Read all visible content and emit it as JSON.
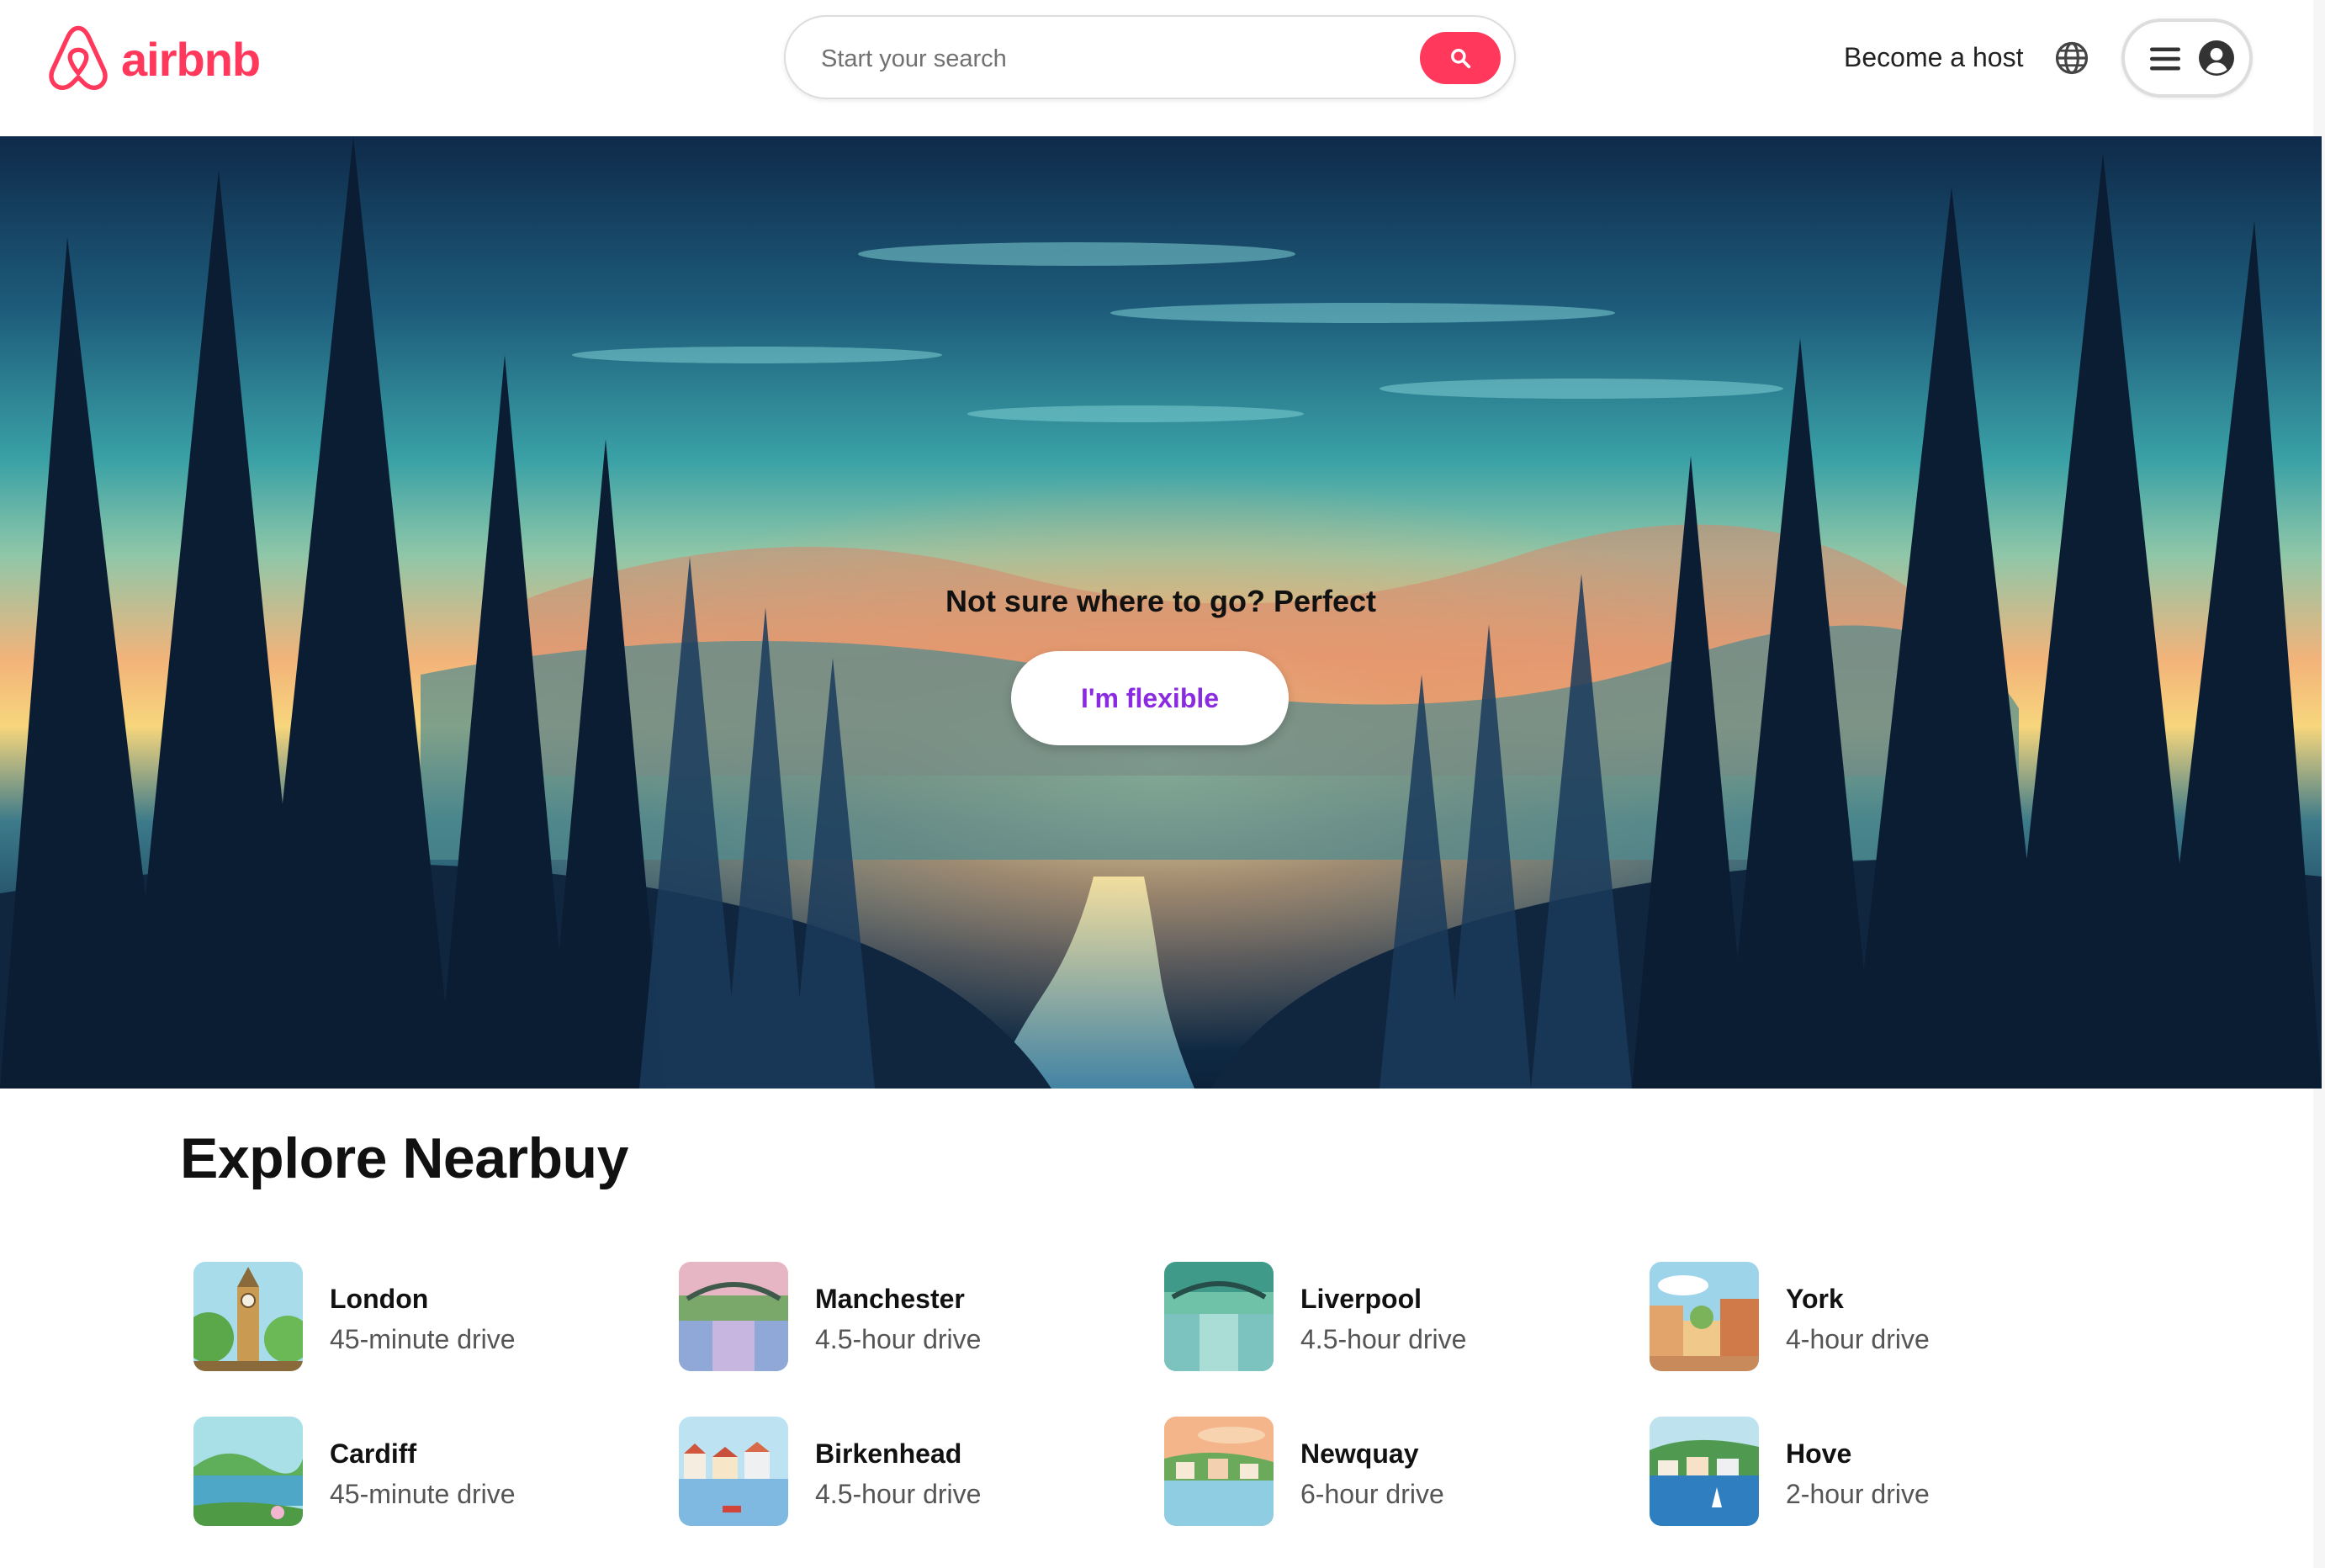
{
  "header": {
    "logo_text": "airbnb",
    "search_placeholder": "Start your search",
    "become_host": "Become a host"
  },
  "hero": {
    "title": "Not sure where to go? Perfect",
    "cta": "I'm flexible"
  },
  "explore": {
    "title": "Explore Nearbuy",
    "items": [
      {
        "city": "London",
        "drive": "45-minute drive"
      },
      {
        "city": "Manchester",
        "drive": "4.5-hour drive"
      },
      {
        "city": "Liverpool",
        "drive": "4.5-hour drive"
      },
      {
        "city": "York",
        "drive": "4-hour drive"
      },
      {
        "city": "Cardiff",
        "drive": "45-minute drive"
      },
      {
        "city": "Birkenhead",
        "drive": "4.5-hour drive"
      },
      {
        "city": "Newquay",
        "drive": "6-hour drive"
      },
      {
        "city": "Hove",
        "drive": "2-hour drive"
      }
    ]
  },
  "icons": {
    "logo": "airbnb-logo-icon",
    "search": "search-icon",
    "globe": "globe-icon",
    "menu": "hamburger-menu-icon",
    "profile": "user-avatar-icon"
  },
  "colors": {
    "brand": "#ff385c",
    "cta_text": "#8a2be2"
  }
}
